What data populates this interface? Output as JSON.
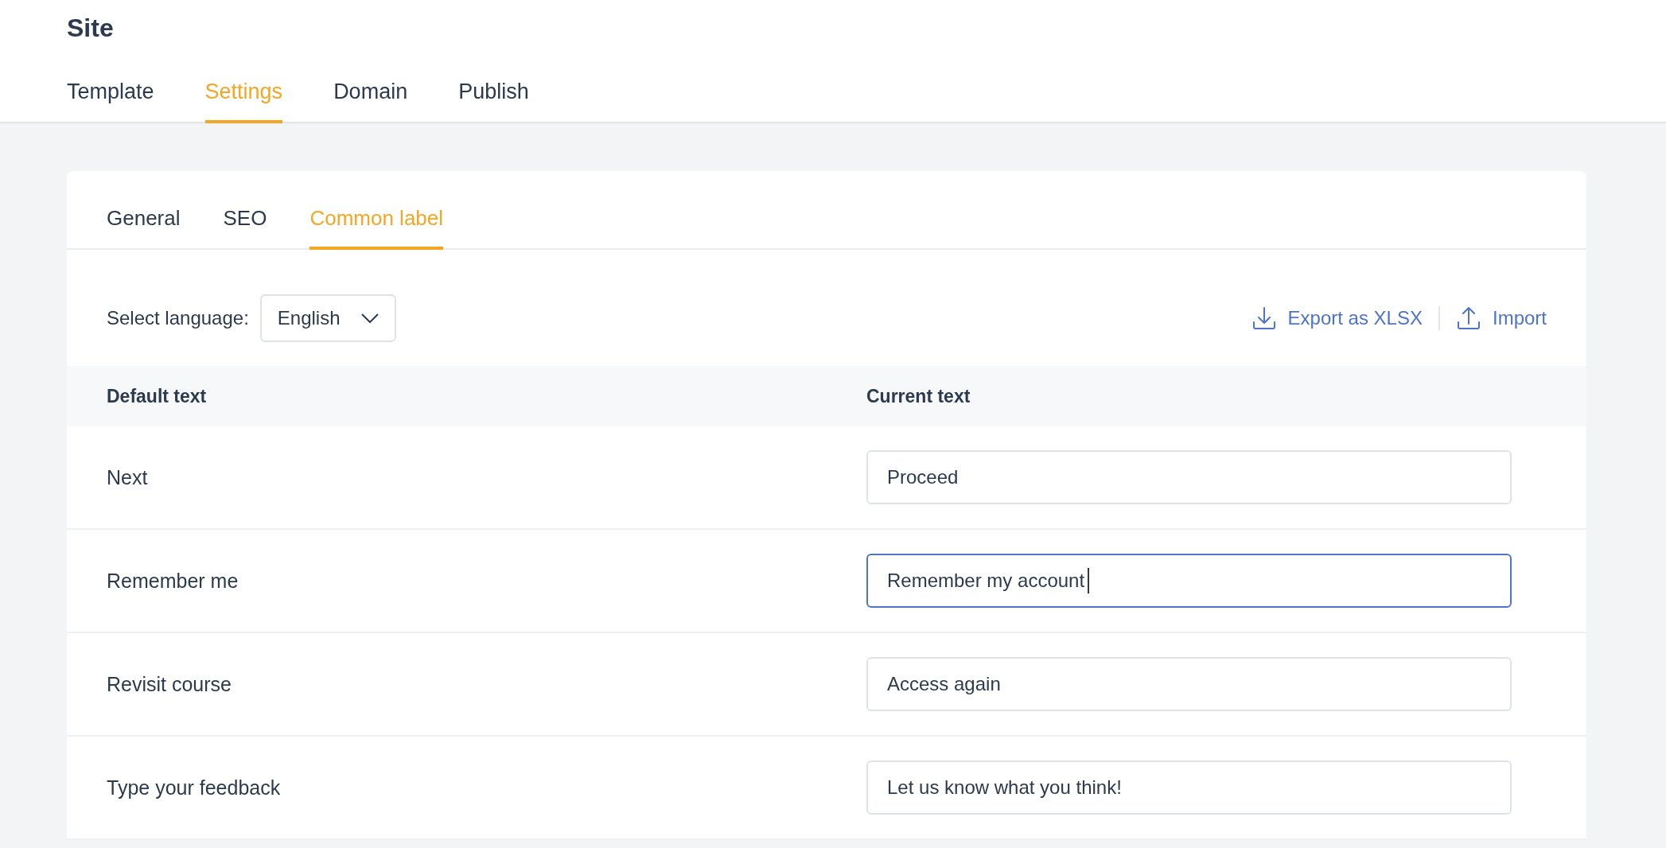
{
  "page_title": "Site",
  "main_tabs": [
    {
      "label": "Template",
      "selected": false
    },
    {
      "label": "Settings",
      "selected": true
    },
    {
      "label": "Domain",
      "selected": false
    },
    {
      "label": "Publish",
      "selected": false
    }
  ],
  "sub_tabs": [
    {
      "label": "General",
      "selected": false
    },
    {
      "label": "SEO",
      "selected": false
    },
    {
      "label": "Common label",
      "selected": true
    }
  ],
  "language": {
    "label": "Select language:",
    "value": "English"
  },
  "actions": [
    {
      "kind": "export",
      "label": "Export as XLSX"
    },
    {
      "kind": "import",
      "label": "Import"
    }
  ],
  "table": {
    "columns": [
      "Default text",
      "Current text"
    ],
    "rows": [
      {
        "default": "Next",
        "current": "Proceed",
        "focused": false
      },
      {
        "default": "Remember me",
        "current": "Remember my account",
        "focused": true
      },
      {
        "default": "Revisit course",
        "current": "Access again",
        "focused": false
      },
      {
        "default": "Type your feedback",
        "current": "Let us know what you think!",
        "focused": false
      }
    ]
  }
}
